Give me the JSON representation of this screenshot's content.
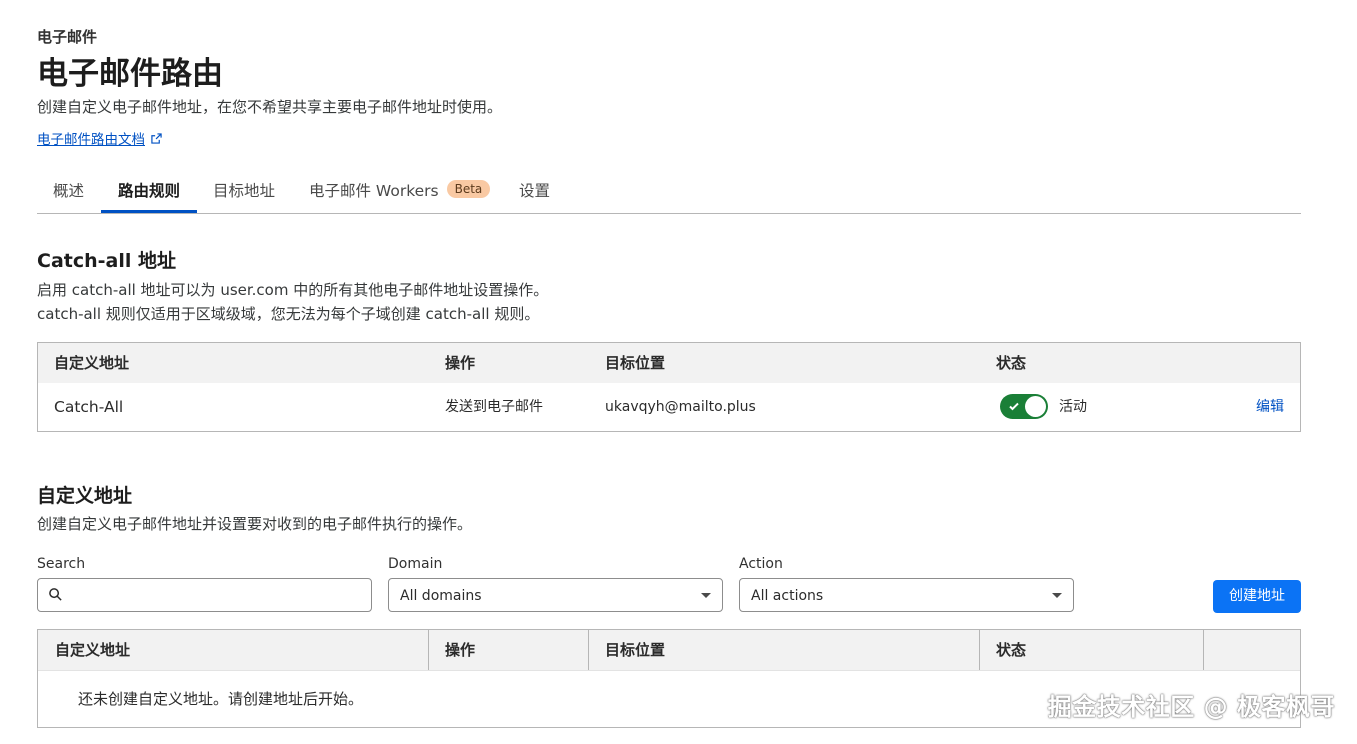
{
  "header": {
    "eyebrow": "电子邮件",
    "title": "电子邮件路由",
    "subtitle": "创建自定义电子邮件地址，在您不希望共享主要电子邮件地址时使用。",
    "doc_link": "电子邮件路由文档",
    "doc_link_icon": "external-link-icon"
  },
  "tabs": [
    {
      "label": "概述",
      "active": false
    },
    {
      "label": "路由规则",
      "active": true
    },
    {
      "label": "目标地址",
      "active": false
    },
    {
      "label": "电子邮件 Workers",
      "active": false,
      "badge": "Beta"
    },
    {
      "label": "设置",
      "active": false
    }
  ],
  "catch_all": {
    "title": "Catch-all 地址",
    "desc_line1": "启用 catch-all 地址可以为 user.com 中的所有其他电子邮件地址设置操作。",
    "desc_line2": "catch-all 规则仅适用于区域级域，您无法为每个子域创建 catch-all 规则。",
    "columns": [
      "自定义地址",
      "操作",
      "目标位置",
      "状态"
    ],
    "row": {
      "address": "Catch-All",
      "action": "发送到电子邮件",
      "destination": "ukavqyh@mailto.plus",
      "status_enabled": true,
      "status_label": "活动",
      "edit_label": "编辑"
    }
  },
  "custom": {
    "title": "自定义地址",
    "desc": "创建自定义电子邮件地址并设置要对收到的电子邮件执行的操作。",
    "filters": {
      "search_label": "Search",
      "search_value": "",
      "domain_label": "Domain",
      "domain_value": "All domains",
      "action_label": "Action",
      "action_value": "All actions"
    },
    "create_button": "创建地址",
    "columns": [
      "自定义地址",
      "操作",
      "目标位置",
      "状态",
      ""
    ],
    "empty_text": "还未创建自定义地址。请创建地址后开始。"
  },
  "watermark": "掘金技术社区 @ 极客枫哥",
  "colors": {
    "link": "#0051c3",
    "primary_button": "#0b73f5",
    "toggle_on": "#1a7f37",
    "beta_badge": "#f9c9a3"
  }
}
